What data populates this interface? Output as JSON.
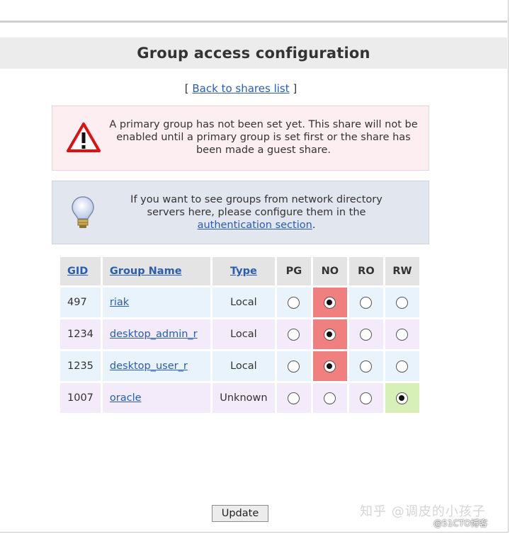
{
  "page": {
    "title": "Group access configuration",
    "back_prefix": "[ ",
    "back_link": "Back to shares list",
    "back_suffix": " ]"
  },
  "warning": {
    "icon": "warning-triangle-icon",
    "text": "A primary group has not been set yet. This share will not be enabled until a primary group is set first or the share has been made a guest share."
  },
  "info": {
    "icon": "lightbulb-icon",
    "text_before": "If you want to see groups from network directory servers here, please configure them in the ",
    "link": "authentication section",
    "text_after": "."
  },
  "table": {
    "headers": {
      "gid": "GID",
      "name": "Group Name",
      "type": "Type",
      "pg": "PG",
      "no": "NO",
      "ro": "RO",
      "rw": "RW"
    },
    "rows": [
      {
        "gid": "497",
        "name": "riak",
        "type": "Local",
        "selected": "NO"
      },
      {
        "gid": "1234",
        "name": "desktop_admin_r",
        "type": "Local",
        "selected": "NO"
      },
      {
        "gid": "1235",
        "name": "desktop_user_r",
        "type": "Local",
        "selected": "NO"
      },
      {
        "gid": "1007",
        "name": "oracle",
        "type": "Unknown",
        "selected": "RW"
      }
    ],
    "colors": {
      "row_a": "#e9f3fb",
      "row_b": "#f3eafa",
      "no_selected": "#f08080",
      "rw_selected": "#d7f0b8"
    }
  },
  "buttons": {
    "update": "Update"
  },
  "watermark": {
    "main": "知乎 @调皮的小孩子",
    "corner": "@51CTO博客"
  }
}
